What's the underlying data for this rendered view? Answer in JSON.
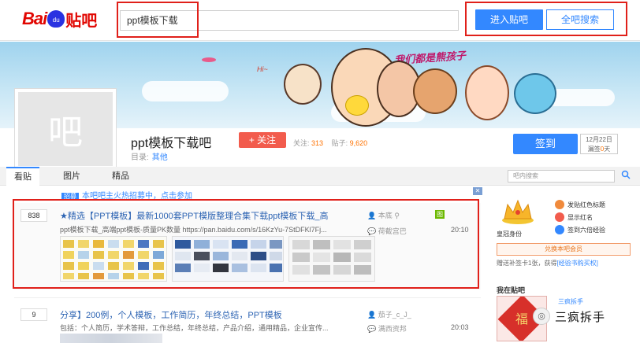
{
  "header": {
    "logo_text_bai": "Bai",
    "logo_text_du": "du",
    "logo_text_tieba": "贴吧",
    "search_value": "ppt模板下载",
    "enter_button": "进入贴吧",
    "search_all_button": "全吧搜索"
  },
  "banner": {
    "slogan": "我们都是熊孩子",
    "speech": "Hi~"
  },
  "forum": {
    "avatar_char": "吧",
    "name": "ppt模板下载吧",
    "follow_label": "+ 关注",
    "follow_count_label": "关注:",
    "follow_count": "313",
    "posts_label": "贴子:",
    "posts_count": "9,620",
    "catalog_label": "目录:",
    "catalog_value": "其他",
    "sign_button": "签到",
    "sign_date": "12月22日",
    "sign_streak_prefix": "漏签",
    "sign_streak_value": "0",
    "sign_streak_suffix": "天"
  },
  "tabs": [
    {
      "label": "看贴"
    },
    {
      "label": "图片"
    },
    {
      "label": "精品"
    }
  ],
  "inner_search": {
    "placeholder": "吧内搜索"
  },
  "notice": {
    "tag": "招募",
    "text": "本吧吧主火热招募中，点击参加"
  },
  "threads": [
    {
      "reply_count": "838",
      "title": "★精选【PPT模板】最新1000套PPT模版整理合集下载ppt模板下载_高",
      "desc": "ppt模板下载_高端ppt模板-质量PK数量 https://pan.baidu.com/s/16KzYu-7StDFKl7Fj...",
      "author": "本底",
      "last_reply": "荷截宫巴",
      "time": "20:10",
      "badge": "图"
    },
    {
      "reply_count": "9",
      "title": "分享】200例，个人模板，工作简历，年终总结，PPT模板",
      "desc": "包括：个人简历，学术答辩，工作总结，年终总结，产品介绍，通用精品，企业宣传...",
      "author": "茄子_c_J_",
      "last_reply": "满西资邦",
      "time": "20:03"
    }
  ],
  "right_panel": {
    "crown_caption": "皇冠身份",
    "perks": [
      {
        "label": "发贴红色标题",
        "color": "#f08a3c"
      },
      {
        "label": "显示红名",
        "color": "#f25c4d"
      },
      {
        "label": "签到六倍经验",
        "color": "#3388ff"
      }
    ],
    "member_button": "兑换本吧会员",
    "gift_text": "赠送补签卡1张，获得",
    "gift_link": "[经验书购买权]",
    "my_tieba_title": "我在贴吧",
    "my_name": "三疯拆手"
  },
  "watermark": {
    "text": "三疯拆手"
  }
}
